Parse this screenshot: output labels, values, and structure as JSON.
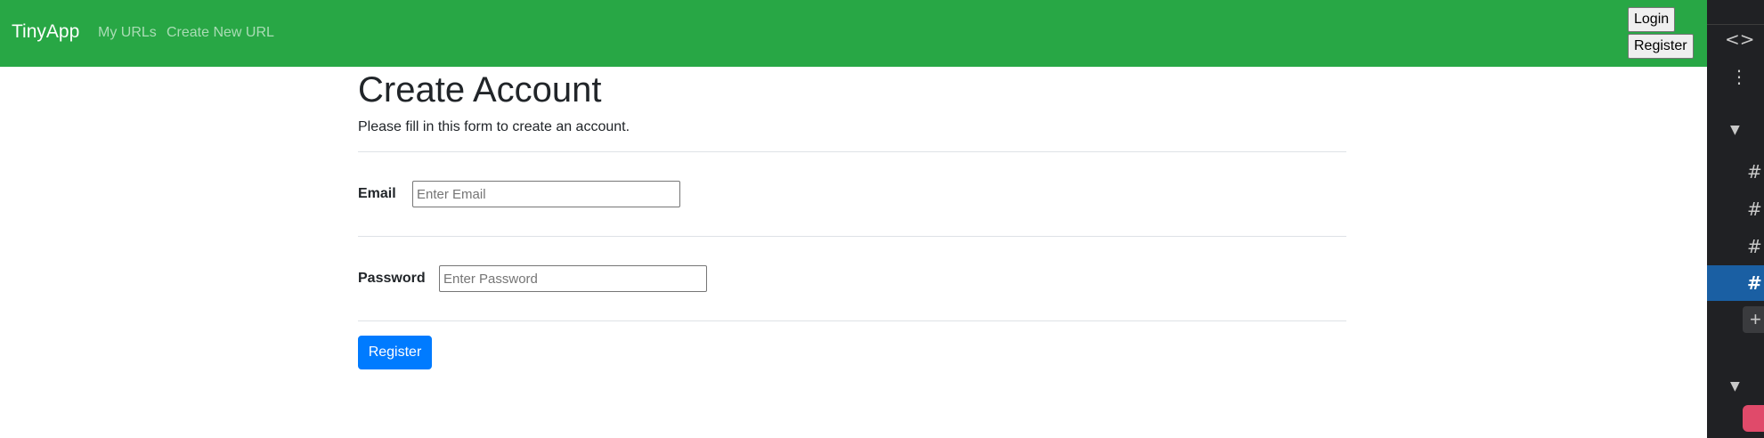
{
  "navbar": {
    "brand": "TinyApp",
    "links": [
      "My URLs",
      "Create New URL"
    ],
    "login_label": "Login",
    "register_label": "Register",
    "background_color": "#28a745"
  },
  "form": {
    "title": "Create Account",
    "subtitle": "Please fill in this form to create an account.",
    "email_label": "Email",
    "email_placeholder": "Enter Email",
    "email_value": "",
    "password_label": "Password",
    "password_placeholder": "Enter Password",
    "password_value": "",
    "submit_label": "Register",
    "submit_color": "#007bff"
  },
  "side_panel": {
    "icons": [
      "code-icon",
      "more-vert-icon",
      "chevron-down-icon",
      "hash-icon",
      "hash-icon",
      "hash-icon",
      "hash-icon",
      "add-icon",
      "chevron-down-icon",
      "app-icon"
    ],
    "active_index": 3,
    "active_color": "#1a5fa3"
  }
}
